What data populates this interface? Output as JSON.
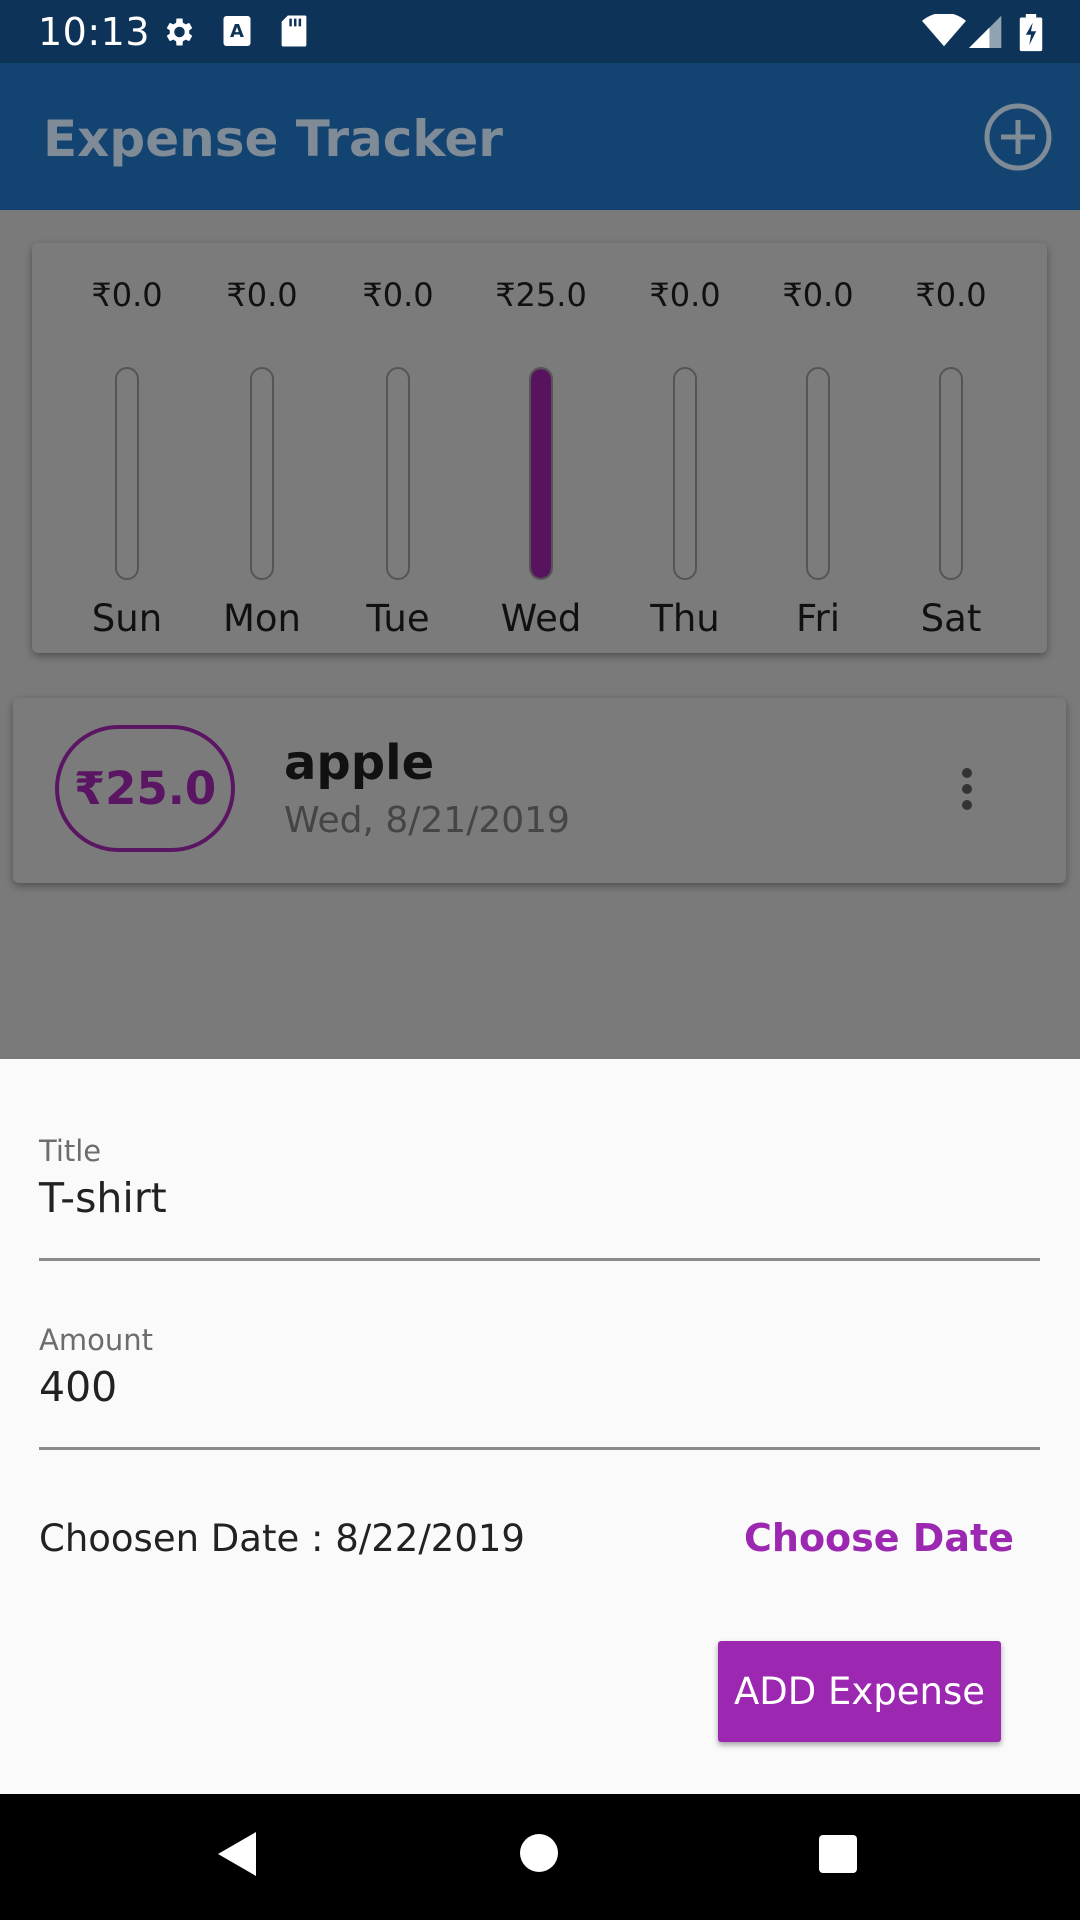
{
  "status_bar": {
    "time": "10:13",
    "icons": [
      "settings-icon",
      "a-box-icon",
      "sd-card-icon",
      "wifi-icon",
      "cell-signal-icon",
      "battery-charging-icon"
    ]
  },
  "app_bar": {
    "title": "Expense Tracker",
    "add_icon": "add-circle-icon"
  },
  "chart": {
    "fill_color": "#58135e",
    "days": [
      {
        "label": "Sun",
        "amount": "₹0.0",
        "fill": 0
      },
      {
        "label": "Mon",
        "amount": "₹0.0",
        "fill": 0
      },
      {
        "label": "Tue",
        "amount": "₹0.0",
        "fill": 0
      },
      {
        "label": "Wed",
        "amount": "₹25.0",
        "fill": 1
      },
      {
        "label": "Thu",
        "amount": "₹0.0",
        "fill": 0
      },
      {
        "label": "Fri",
        "amount": "₹0.0",
        "fill": 0
      },
      {
        "label": "Sat",
        "amount": "₹0.0",
        "fill": 0
      }
    ]
  },
  "transactions": [
    {
      "amount": "₹25.0",
      "title": "apple",
      "date": "Wed, 8/21/2019",
      "menu_icon": "more-vert-icon"
    }
  ],
  "sheet": {
    "title_label": "Title",
    "title_value": "T-shirt",
    "amount_label": "Amount",
    "amount_value": "400",
    "date_text": "Choosen Date : 8/22/2019",
    "choose_date_label": "Choose Date",
    "add_button_label": "ADD Expense",
    "accent_color": "#9c27b0"
  },
  "nav_bar": {
    "icons": [
      "back-icon",
      "home-icon",
      "recents-icon"
    ]
  }
}
